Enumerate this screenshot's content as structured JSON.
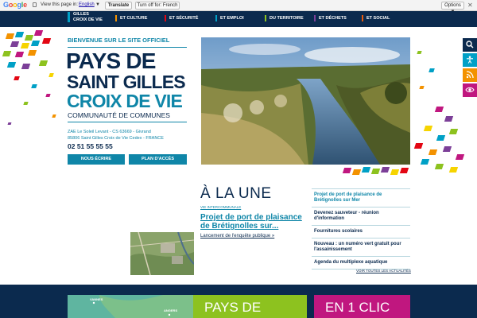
{
  "translate_bar": {
    "logo": [
      "G",
      "o",
      "o",
      "g",
      "l",
      "e"
    ],
    "message": "View this page in:",
    "language": "English",
    "language_arrow": "▼",
    "translate_label": "Translate",
    "turn_off_label": "Turn off for: French",
    "options_label": "Options ▼",
    "close_label": "✕"
  },
  "nav": {
    "brand_line1": "GILLES",
    "brand_line2": "CROIX DE VIE",
    "items": [
      {
        "label": "ET CULTURE",
        "color": "#f39200"
      },
      {
        "label": "ET SÉCURITÉ",
        "color": "#e30613"
      },
      {
        "label": "ET EMPLOI",
        "color": "#00a0c6"
      },
      {
        "label": "DU TERRITOIRE",
        "color": "#8dc21f"
      },
      {
        "label": "ET DÉCHETS",
        "color": "#7c3f98"
      },
      {
        "label": "ET SOCIAL",
        "color": "#e95a0c"
      }
    ]
  },
  "hero": {
    "kicker": "BIENVENUE SUR LE SITE OFFICIEL",
    "title1": "PAYS DE",
    "title2": "SAINT GILLES",
    "title3": "CROIX DE VIE",
    "title4": "COMMUNAUTÉ DE COMMUNES",
    "address1": "ZAE Le Soleil Levant - CS 63669 - Givrand",
    "address2": "85806 Saint Gilles Croix de Vie Cedex - FRANCE",
    "phone": "02 51 55 55 55",
    "write_button": "NOUS ÉCRIRE",
    "map_button": "PLAN D'ACCÈS"
  },
  "side_tools": [
    {
      "icon": "search-icon",
      "color": "#0b2a4e"
    },
    {
      "icon": "accessibility-icon",
      "color": "#00a0c6"
    },
    {
      "icon": "rss-icon",
      "color": "#f39200"
    },
    {
      "icon": "eye-icon",
      "color": "#c0177f"
    }
  ],
  "news": {
    "heading": "À LA UNE",
    "category": "VIE INTERCOMMUNALE",
    "article_title": "Projet de port de plaisance de Brétignolles sur...",
    "article_link": "Lancement de l'enquête publique »",
    "list": [
      {
        "label": "Projet de port de plaisance de Brétignolles sur Mer",
        "active": true
      },
      {
        "label": "Devenez sauveteur - réunion d'information",
        "active": false
      },
      {
        "label": "Fournitures scolaires",
        "active": false
      },
      {
        "label": "Nouveau : un numéro vert gratuit pour l'assainissement",
        "active": false
      },
      {
        "label": "Agenda du multiplexe aquatique",
        "active": false
      }
    ],
    "all_link": "VOIR TOUTES LES ACTUALITÉS"
  },
  "footer": {
    "map_labels": [
      "VANNES",
      "ANGERS"
    ],
    "green_title": "PAYS DE",
    "pink_title": "EN 1 CLIC"
  }
}
